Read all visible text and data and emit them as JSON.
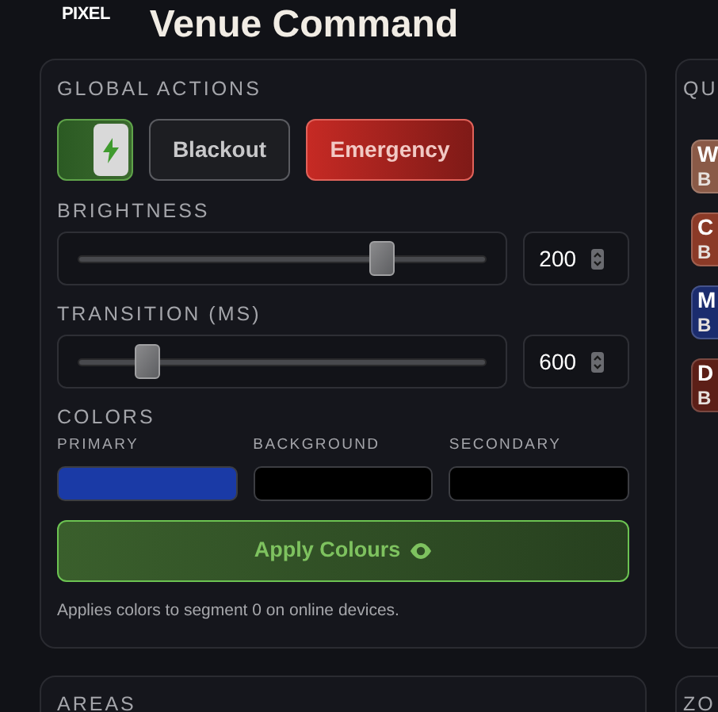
{
  "header": {
    "logo_text": "PIXEL",
    "title": "Venue Command"
  },
  "global_actions": {
    "heading": "GLOBAL ACTIONS",
    "power": {
      "on": true
    },
    "buttons": [
      {
        "label": "Blackout",
        "kind": "neutral"
      },
      {
        "label": "Emergency",
        "kind": "danger"
      }
    ],
    "sliders": [
      {
        "label": "BRIGHTNESS",
        "level": 0.76,
        "value": "200"
      },
      {
        "label": "TRANSITION (MS)",
        "level": 0.15,
        "value": "600"
      }
    ],
    "colors_heading": "COLORS",
    "colors": [
      {
        "label": "PRIMARY",
        "color": "#1a3aa6"
      },
      {
        "label": "BACKGROUND",
        "color": "#000000"
      },
      {
        "label": "SECONDARY",
        "color": "#000000"
      }
    ],
    "apply_button": "Apply Colours",
    "note": "Applies colors to segment 0 on online devices."
  },
  "quick_panel": {
    "heading": "QU",
    "cards": [
      {
        "title": "W",
        "subtitle": "B",
        "color": "#8a5a47"
      },
      {
        "title": "C",
        "subtitle": "B",
        "color": "#8b3a27"
      },
      {
        "title": "M",
        "subtitle": "B",
        "color": "#1b2c6e"
      },
      {
        "title": "D",
        "subtitle": "B",
        "color": "#5c1f17"
      }
    ]
  },
  "areas_panel": {
    "heading": "AREAS"
  },
  "zones_panel": {
    "heading": "ZO"
  }
}
